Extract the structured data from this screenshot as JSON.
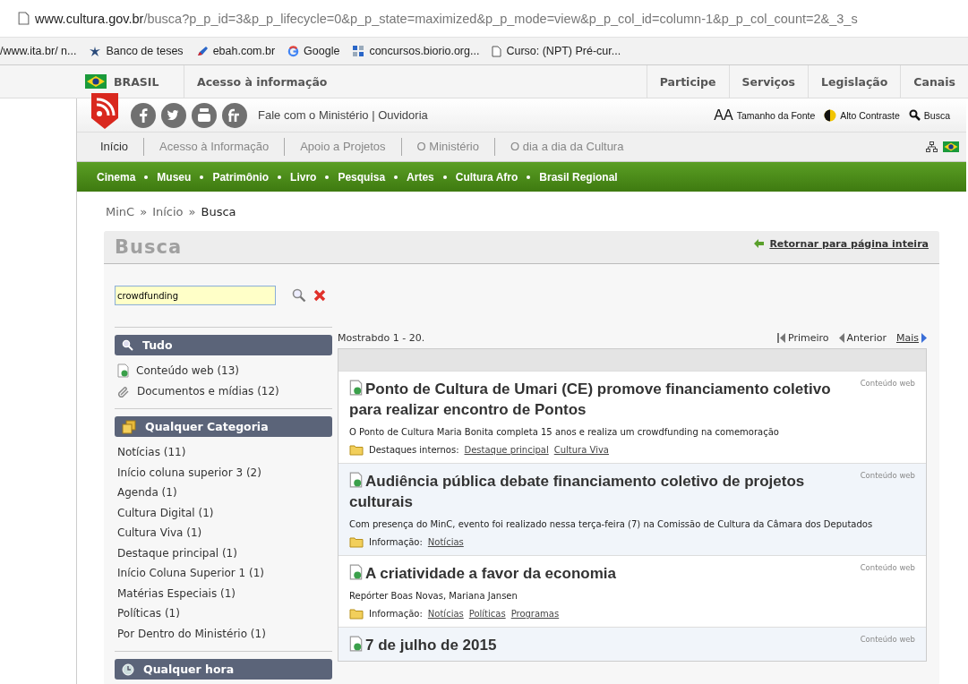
{
  "browser": {
    "url_host": "www.cultura.gov.br",
    "url_path": "/busca?p_p_id=3&p_p_lifecycle=0&p_p_state=maximized&p_p_mode=view&p_p_col_id=column-1&p_p_col_count=2&_3_s",
    "bookmarks": [
      "/www.ita.br/ n...",
      "Banco de teses",
      "ebah.com.br",
      "Google",
      "concursos.biorio.org...",
      "Curso: (NPT) Pré-cur..."
    ]
  },
  "gov_bar": {
    "brand": "BRASIL",
    "access": "Acesso à informação",
    "links": [
      "Participe",
      "Serviços",
      "Legislação",
      "Canais"
    ]
  },
  "header": {
    "contact": "Fale com o Ministério | Ouvidoria",
    "font_size_mark": "AA",
    "font_size": "Tamanho da Fonte",
    "contrast": "Alto Contraste",
    "search": "Busca"
  },
  "main_nav": [
    {
      "label": "Início",
      "selected": true
    },
    {
      "label": "Acesso à Informação",
      "selected": false
    },
    {
      "label": "Apoio a Projetos",
      "selected": false
    },
    {
      "label": "O Ministério",
      "selected": false
    },
    {
      "label": "O dia a dia da Cultura",
      "selected": false
    }
  ],
  "green_nav": [
    "Cinema",
    "Museu",
    "Patrimônio",
    "Livro",
    "Pesquisa",
    "Artes",
    "Cultura Afro",
    "Brasil Regional"
  ],
  "breadcrumb": [
    "MinC",
    "Início",
    "Busca"
  ],
  "breadcrumb_separator": "»",
  "portlet": {
    "title": "Busca",
    "return_link": "Retornar para página inteira"
  },
  "search": {
    "value": "crowdfunding"
  },
  "facets": [
    {
      "title": "Tudo",
      "items": [
        "Conteúdo web (13)",
        "Documentos e mídias (12)"
      ]
    },
    {
      "title": "Qualquer Categoria",
      "items": [
        "Notícias (11)",
        "Início coluna superior 3 (2)",
        "Agenda (1)",
        "Cultura Digital (1)",
        "Cultura Viva (1)",
        "Destaque principal (1)",
        "Início Coluna Superior 1 (1)",
        "Matérias Especiais (1)",
        "Políticas (1)",
        "Por Dentro do Ministério (1)"
      ]
    },
    {
      "title": "Qualquer hora"
    }
  ],
  "results": {
    "summary": "Mostrabdo 1 - 20.",
    "pager": {
      "first": "Primeiro",
      "previous": "Anterior",
      "more": "Mais"
    },
    "items": [
      {
        "title": "Ponto de Cultura de Umari (CE) promove financiamento coletivo para realizar encontro de Pontos",
        "type": "Conteúdo web",
        "snippet": "O Ponto de Cultura Maria Bonita completa 15 anos e realiza um crowdfunding na comemoração",
        "tag_label": "Destaques internos:",
        "tags": [
          "Destaque principal",
          "Cultura Viva"
        ]
      },
      {
        "title": "Audiência pública debate financiamento coletivo de projetos culturais",
        "type": "Conteúdo web",
        "snippet": "Com presença do MinC, evento foi realizado nessa terça-feira (7) na Comissão de Cultura da Câmara dos Deputados",
        "tag_label": "Informação:",
        "tags": [
          "Notícias"
        ]
      },
      {
        "title": "A criatividade a favor da economia",
        "type": "Conteúdo web",
        "snippet": "Repórter Boas Novas, Mariana Jansen",
        "tag_label": "Informação:",
        "tags": [
          "Notícias",
          "Políticas",
          "Programas"
        ]
      },
      {
        "title": "7 de julho de 2015",
        "type": "Conteúdo web"
      }
    ]
  }
}
